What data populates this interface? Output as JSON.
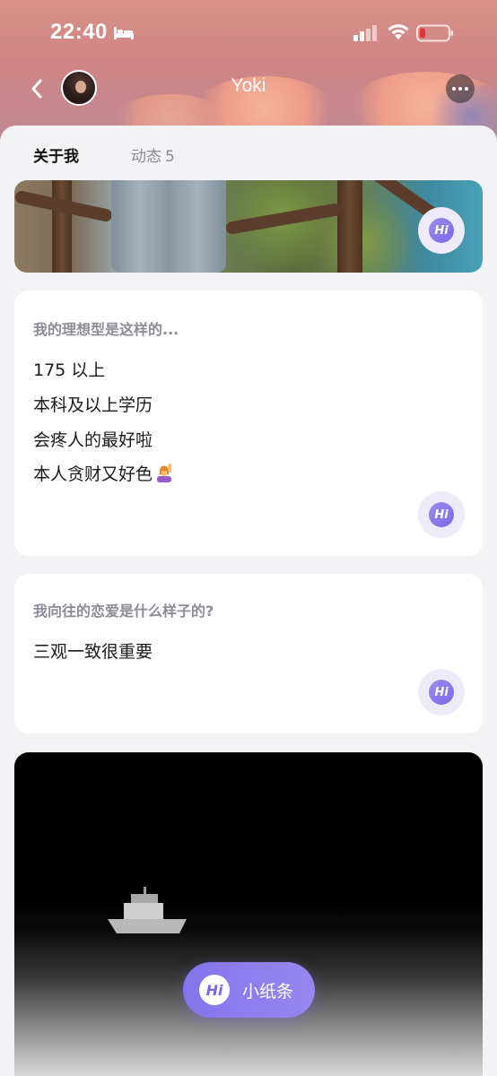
{
  "status_bar": {
    "time": "22:40",
    "icons": [
      "bed-icon",
      "cellular-signal-icon",
      "wifi-icon",
      "battery-low-icon"
    ]
  },
  "nav": {
    "title": "Yoki",
    "back_icon": "chevron-left-icon",
    "more_icon": "more-dots-icon"
  },
  "tabs": [
    {
      "label": "关于我",
      "active": true
    },
    {
      "label": "动态",
      "count": "5",
      "active": false
    }
  ],
  "cards": [
    {
      "question": "我的理想型是这样的...",
      "answers": [
        "175 以上",
        "本科及以上学历",
        "会疼人的最好啦",
        "本人贪财又好色"
      ],
      "answer_emoji": "person-raising-hand-emoji"
    },
    {
      "question": "我向往的恋爱是什么样子的?",
      "answers": [
        "三观一致很重要"
      ]
    }
  ],
  "hi_badge_text": "Hi",
  "floating_button": {
    "label": "小纸条",
    "icon_text": "Hi"
  },
  "colors": {
    "accent": "#8474ec",
    "battery_low": "#e8323c",
    "question_text": "#8c8c96"
  }
}
